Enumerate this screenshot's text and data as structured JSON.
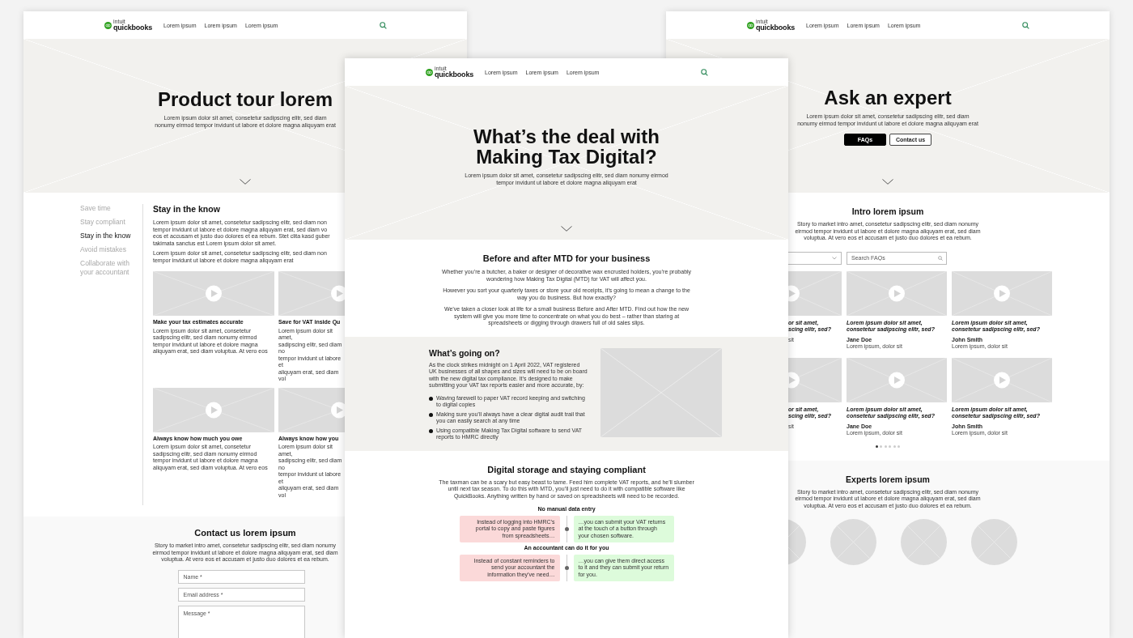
{
  "left_page": {
    "header": {
      "logo_small": "intuit",
      "logo": "quickbooks",
      "nav": [
        "Lorem ipsum",
        "Lorem ipsum",
        "Lorem ipsum"
      ]
    },
    "hero": {
      "title": "Product tour lorem",
      "subtitle": "Lorem ipsum dolor sit amet, consetetur sadipscing elitr, sed diam nonumy eirmod tempor invidunt ut labore et dolore magna aliquyam erat"
    },
    "sidebar": {
      "items": [
        {
          "label": "Save time",
          "selected": false
        },
        {
          "label": "Stay compliant",
          "selected": false
        },
        {
          "label": "Stay in the know",
          "selected": true
        },
        {
          "label": "Avoid mistakes",
          "selected": false
        },
        {
          "label": "Collaborate with your accountant",
          "selected": false
        }
      ]
    },
    "article": {
      "heading": "Stay in the know",
      "paragraphs": [
        "Lorem ipsum dolor sit amet, consetetur sadipscing elitr, sed diam non\ntempor invidunt ut labore et dolore magna aliquyam erat, sed diam vo\neos et accusam et justo duo dolores et ea rebum. Stet clita kasd guber\ntakimata sanctus est Lorem ipsum dolor sit amet.",
        "Lorem ipsum dolor sit amet, consetetur sadipscing elitr, sed diam non\ntempor invidunt ut labore et dolore magna aliquyam erat"
      ],
      "cards": [
        {
          "kind": "full",
          "title": "Make your tax estimates accurate",
          "text": "Lorem ipsum dolor sit amet, consetetur\nsadipscing elitr, sed diam nonumy eirmod\ntempor invidunt ut labore et dolore magna\naliquyam erat, sed diam voluptua. At vero eos"
        },
        {
          "kind": "cut",
          "title": "Save for VAT inside Qu",
          "text": "Lorem ipsum dolor sit amet,\nsadipscing elitr, sed diam no\ntempor invidunt ut labore et\naliquyam erat, sed diam vol"
        },
        {
          "kind": "full",
          "title": "Always know how much you owe",
          "text": "Lorem ipsum dolor sit amet, consetetur\nsadipscing elitr, sed diam nonumy eirmod\ntempor invidunt ut labore et dolore magna\naliquyam erat, sed diam voluptua. At vero eos"
        },
        {
          "kind": "cut",
          "title": "Always know how you",
          "text": "Lorem ipsum dolor sit amet,\nsadipscing elitr, sed diam no\ntempor invidunt ut labore et\naliquyam erat, sed diam vol"
        }
      ]
    },
    "contact": {
      "heading": "Contact us lorem ipsum",
      "text": "Story to market intro amet, consetetur sadipscing elitr, sed diam nonumy eirmod tempor invidunt ut labore et dolore magna aliquyam erat, sed diam voluptua. At vero eos et accusam et justo duo dolores et ea rebum.",
      "fields": [
        {
          "kind": "input",
          "placeholder": "Name *"
        },
        {
          "kind": "input",
          "placeholder": "Email address *"
        },
        {
          "kind": "textarea",
          "placeholder": "Message *"
        }
      ]
    }
  },
  "center_page": {
    "header": {
      "logo_small": "intuit",
      "logo": "quickbooks",
      "nav": [
        "Lorem ipsum",
        "Lorem ipsum",
        "Lorem ipsum"
      ]
    },
    "hero": {
      "title": "What’s the deal with\nMaking Tax Digital?",
      "subtitle": "Lorem ipsum dolor sit amet, consetetur sadipscing elitr, sed diam nonumy eirmod tempor invidunt ut labore et dolore magna aliquyam erat"
    },
    "before_after": {
      "heading": "Before and after MTD for your business",
      "paragraphs": [
        "Whether you’re a butcher, a baker or designer of decorative wax encrusted holders, you’re probably wondering how Making Tax Digital (MTD) for VAT will affect you.",
        "However you sort your quarterly taxes or store your old receipts, it’s going to mean a change to the way you do business. But how exactly?",
        "We’ve taken a closer look at life for a small business Before and After MTD. Find out how the new system will give you more time to concentrate on what you do best – rather than staring at spreadsheets or digging through drawers full of old sales slips."
      ]
    },
    "whats_going_on": {
      "heading": "What’s going on?",
      "text": "As the clock strikes midnight on 1 April 2022, VAT registered UK businesses of all shapes and sizes will need to be on board with the new digital tax compliance. It’s designed to make submitting your VAT tax reports easier and more accurate, by:",
      "bullets": [
        "Waving farewell to paper VAT record keeping and switching to digital copies",
        "Making sure you’ll always have a clear digital audit trail that you can easily search at any time",
        "Using compatible Making Tax Digital software to send VAT reports to HMRC directly"
      ]
    },
    "compliance": {
      "heading": "Digital storage and staying compliant",
      "text": "The taxman can be a scary but easy beast to tame. Feed him complete VAT reports, and he’ll slumber until next tax season. To do this with MTD, you’ll just need to do it with compatible software like QuickBooks. Anything written by hand or saved on spreadsheets will need to be recorded.",
      "steps": [
        {
          "label": "No manual data entry",
          "before": "Instead of logging into HMRC’s portal to copy and paste figures from spreadsheets…",
          "after": "…you can submit your VAT returns at the touch of a button through your chosen software."
        },
        {
          "label": "An accountant can do it for you",
          "before": "Instead of constant reminders to send your accountant the information they’ve need…",
          "after": "…you can give them direct access to it and they can submit your return for you."
        }
      ]
    }
  },
  "right_page": {
    "header": {
      "logo_small": "intuit",
      "logo": "quickbooks",
      "nav": [
        "Lorem ipsum",
        "Lorem ipsum",
        "Lorem ipsum"
      ]
    },
    "hero": {
      "title": "Ask an expert",
      "subtitle": "Lorem ipsum dolor sit amet, consetetur sadipscing elitr, sed diam nonumy eirmod tempor invidunt ut labore et dolore magna aliquyam erat",
      "buttons": [
        {
          "kind": "primary",
          "label": "FAQs"
        },
        {
          "kind": "secondary",
          "label": "Contact us"
        }
      ]
    },
    "intro": {
      "heading": "Intro lorem ipsum",
      "text": "Story to market intro amet, consetetur sadipscing elitr, sed diam nonumy eirmod tempor invidunt ut labore et dolore magna aliquyam erat, sed diam voluptua. At vero eos et accusam et justo duo dolores et ea rebum.",
      "search": {
        "placeholder": "Search FAQs"
      },
      "cards": [
        {
          "kind": "cut",
          "title": "or sit amet,\nscing elitr, sed?",
          "meta": "sit"
        },
        {
          "kind": "full",
          "title": "Lorem ipsum dolor sit amet,\nconsetetur sadipscing elitr, sed?",
          "name": "Jane Doe",
          "meta": "Lorem ipsum, dolor sit"
        },
        {
          "kind": "full",
          "title": "Lorem ipsum dolor sit amet,\nconsetetur sadipscing elitr, sed?",
          "name": "John Smith",
          "meta": "Lorem ipsum, dolor sit"
        },
        {
          "kind": "cut",
          "title": "or sit amet,\nscing elitr, sed?",
          "meta": "sit"
        },
        {
          "kind": "full",
          "title": "Lorem ipsum dolor sit amet,\nconsetetur sadipscing elitr, sed?",
          "name": "Jane Doe",
          "meta": "Lorem ipsum, dolor sit"
        },
        {
          "kind": "full",
          "title": "Lorem ipsum dolor sit amet,\nconsetetur sadipscing elitr, sed?",
          "name": "John Smith",
          "meta": "Lorem ipsum, dolor sit"
        }
      ],
      "pager": [
        {
          "selected": true
        },
        {
          "selected": false
        },
        {
          "selected": false
        },
        {
          "selected": false
        },
        {
          "selected": false
        },
        {
          "selected": false
        }
      ]
    },
    "experts": {
      "heading": "Experts lorem ipsum",
      "text": "Story to market intro amet, consetetur sadipscing elitr, sed diam nonumy eirmod tempor invidunt ut labore et dolore magna aliquyam erat, sed diam voluptua. At vero eos et accusam et justo duo dolores et ea rebum.",
      "avatars": [
        {
          "kind": "cut"
        },
        {
          "kind": "full"
        },
        {
          "kind": "full"
        },
        {
          "kind": "full"
        }
      ]
    }
  }
}
